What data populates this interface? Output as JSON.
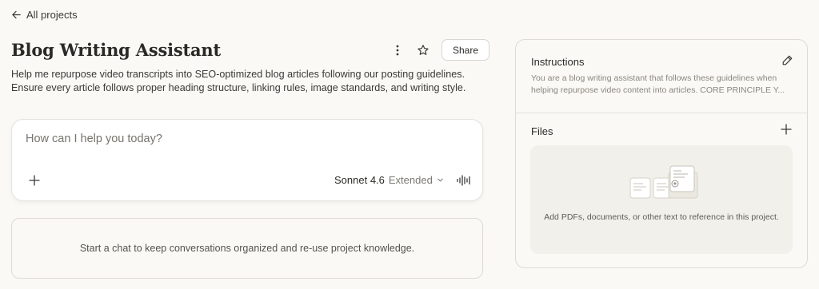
{
  "nav": {
    "back_label": "All projects"
  },
  "project": {
    "title": "Blog Writing Assistant",
    "description": "Help me repurpose video transcripts into SEO-optimized blog articles following our posting guidelines. Ensure every article follows proper heading structure, linking rules, image standards, and writing style.",
    "share_label": "Share"
  },
  "composer": {
    "placeholder": "How can I help you today?",
    "model_name": "Sonnet 4.6",
    "model_mode": "Extended"
  },
  "chats": {
    "empty_text": "Start a chat to keep conversations organized and re-use project knowledge."
  },
  "instructions": {
    "heading": "Instructions",
    "preview": "You are a blog writing assistant that follows these guidelines when helping repurpose video content into articles. CORE PRINCIPLE Y..."
  },
  "files": {
    "heading": "Files",
    "empty_text": "Add PDFs, documents, or other text to reference in this project."
  },
  "icons": {
    "back": "arrow-left-icon",
    "more": "more-vertical-icon",
    "star": "star-icon",
    "add": "plus-icon",
    "model_chevron": "chevron-down-icon",
    "voice": "audio-waveform-icon",
    "edit": "pencil-icon",
    "add_file": "plus-icon"
  }
}
